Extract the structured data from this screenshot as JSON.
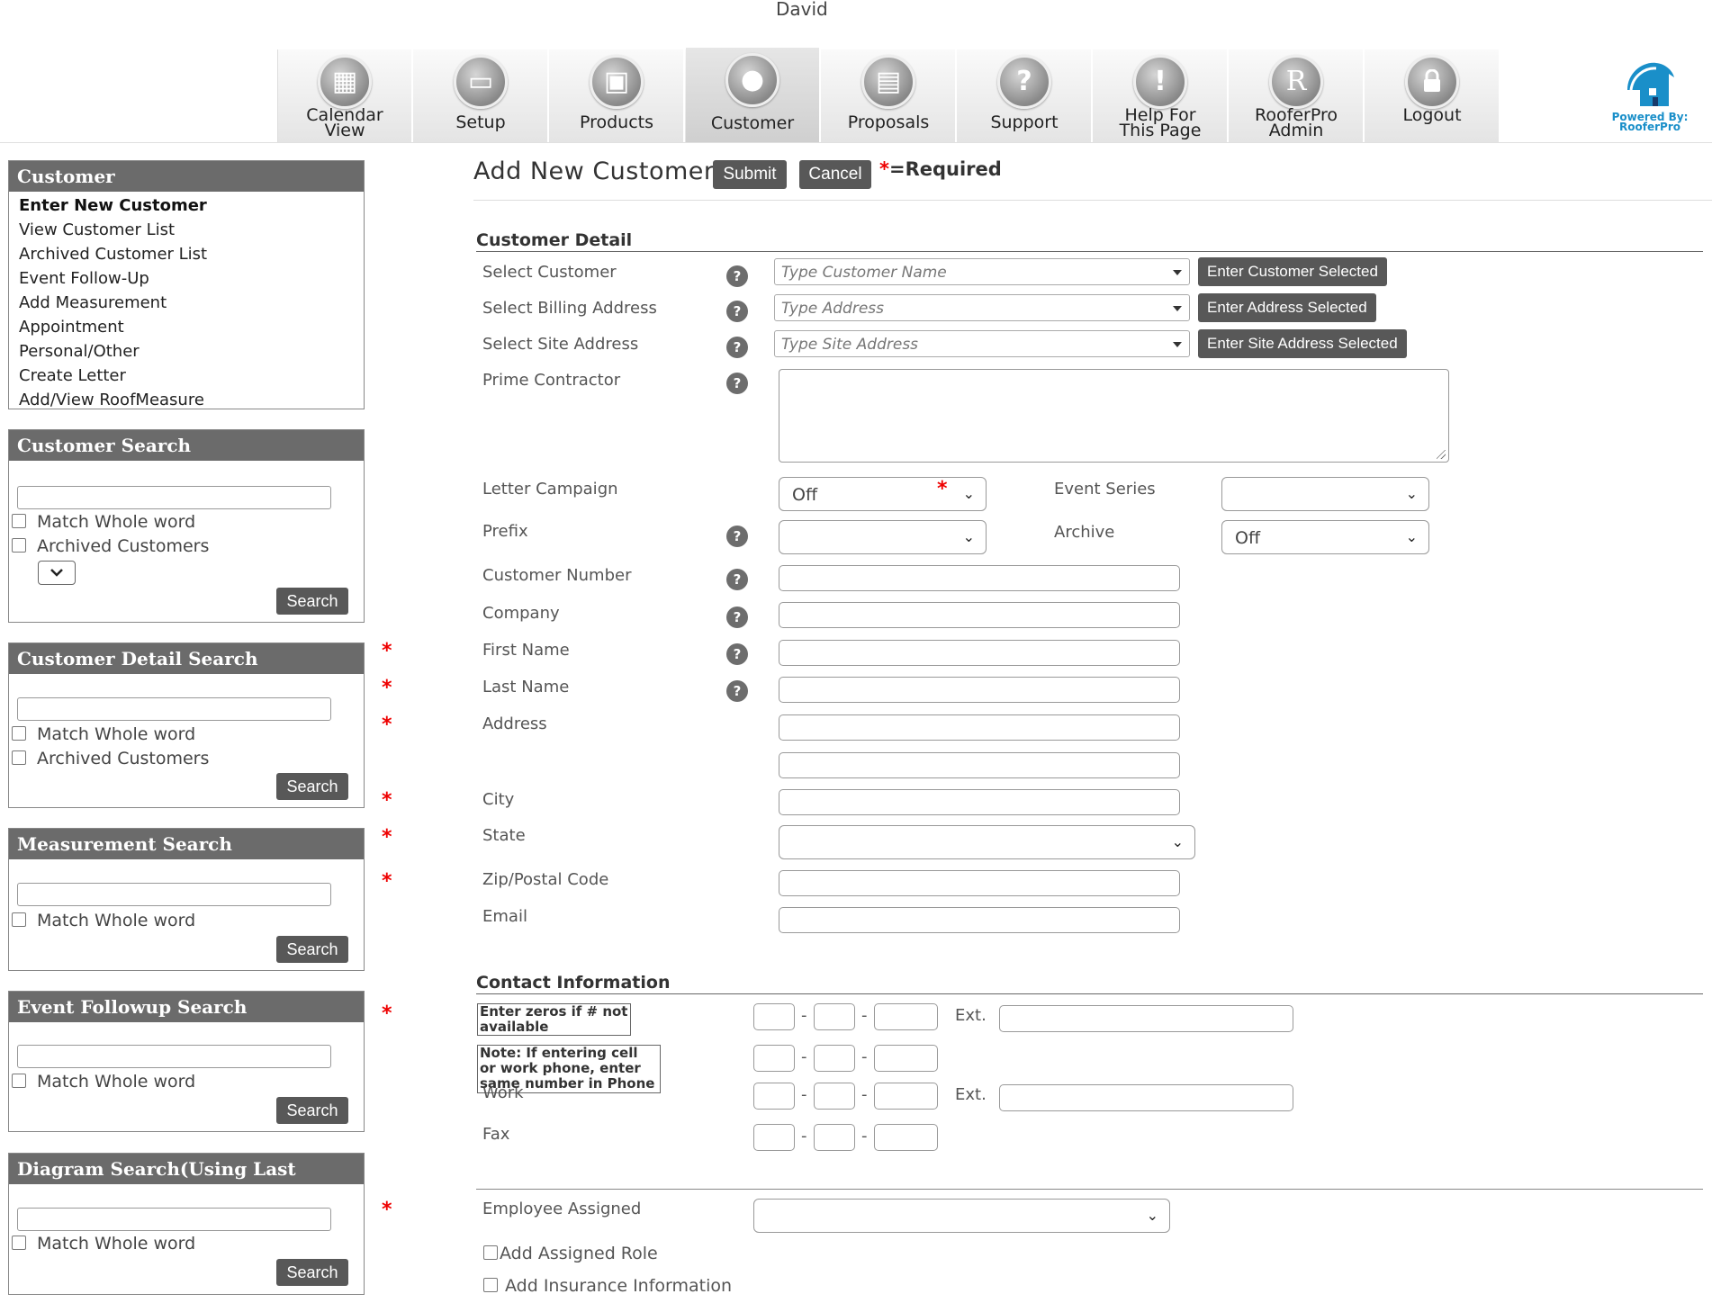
{
  "header": {
    "user": "David",
    "nav": [
      {
        "label1": "Calendar",
        "label2": "View",
        "icon": "calendar-icon",
        "glyph": "▦"
      },
      {
        "label1": "Setup",
        "label2": "",
        "icon": "setup-icon",
        "glyph": "▭"
      },
      {
        "label1": "Products",
        "label2": "",
        "icon": "box-icon",
        "glyph": "▣"
      },
      {
        "label1": "Customer",
        "label2": "",
        "icon": "person-icon",
        "glyph": "●"
      },
      {
        "label1": "Proposals",
        "label2": "",
        "icon": "documents-icon",
        "glyph": "▤"
      },
      {
        "label1": "Support",
        "label2": "",
        "icon": "question-icon",
        "glyph": "?"
      },
      {
        "label1": "Help For",
        "label2": "This Page",
        "icon": "exclamation-icon",
        "glyph": "!"
      },
      {
        "label1": "RooferPro",
        "label2": "Admin",
        "icon": "rooferpro-r-icon",
        "glyph": "R"
      },
      {
        "label1": "Logout",
        "label2": "",
        "icon": "lock-icon",
        "glyph": "🔒"
      }
    ],
    "logo_text1": "Powered By:",
    "logo_text2": "RooferPro"
  },
  "sidebar": {
    "customer": {
      "title": "Customer",
      "items": [
        "Enter New Customer",
        "View Customer List",
        "Archived Customer List",
        "Event Follow-Up",
        "Add Measurement",
        "Appointment",
        "Personal/Other",
        "Create Letter",
        "Add/View RoofMeasure"
      ]
    },
    "customer_search": {
      "title": "Customer Search",
      "match": "Match Whole word",
      "archived": "Archived Customers",
      "button": "Search"
    },
    "detail_search": {
      "title": "Customer Detail Search",
      "match": "Match Whole word",
      "archived": "Archived Customers",
      "button": "Search"
    },
    "measurement_search": {
      "title": "Measurement Search",
      "match": "Match Whole word",
      "button": "Search"
    },
    "event_search": {
      "title": "Event Followup Search",
      "match": "Match Whole word",
      "button": "Search"
    },
    "diagram_search": {
      "title": "Diagram Search(Using Last Name)",
      "match": "Match Whole word",
      "button": "Search"
    }
  },
  "main": {
    "title": "Add New Customer",
    "submit": "Submit",
    "cancel": "Cancel",
    "required_star": "*",
    "required_text": "=Required",
    "customer_detail": {
      "title": "Customer Detail",
      "select_customer": {
        "label": "Select Customer",
        "placeholder": "Type Customer Name",
        "button": "Enter Customer Selected"
      },
      "select_billing": {
        "label": "Select Billing Address",
        "placeholder": "Type Address",
        "button": "Enter Address Selected"
      },
      "select_site": {
        "label": "Select Site Address",
        "placeholder": "Type Site Address",
        "button": "Enter Site Address Selected"
      },
      "prime_contractor": "Prime Contractor",
      "letter_campaign": {
        "label": "Letter Campaign",
        "value": "Off"
      },
      "event_series": {
        "label": "Event Series",
        "value": ""
      },
      "prefix": {
        "label": "Prefix",
        "value": ""
      },
      "archive": {
        "label": "Archive",
        "value": "Off"
      },
      "customer_number": "Customer Number",
      "company": "Company",
      "first_name": "First Name",
      "last_name": "Last Name",
      "address": "Address",
      "city": "City",
      "state": "State",
      "zip": "Zip/Postal Code",
      "email": "Email"
    },
    "contact": {
      "title": "Contact Information",
      "note1": "Enter zeros if # not available",
      "note2": "Note: If entering cell or work phone, enter same number in Phone",
      "ext": "Ext.",
      "fax": "Fax",
      "work": "Work"
    },
    "employee": {
      "label": "Employee Assigned",
      "value": ""
    },
    "add_role": "Add Assigned Role",
    "add_insurance": "Add Insurance Information"
  }
}
